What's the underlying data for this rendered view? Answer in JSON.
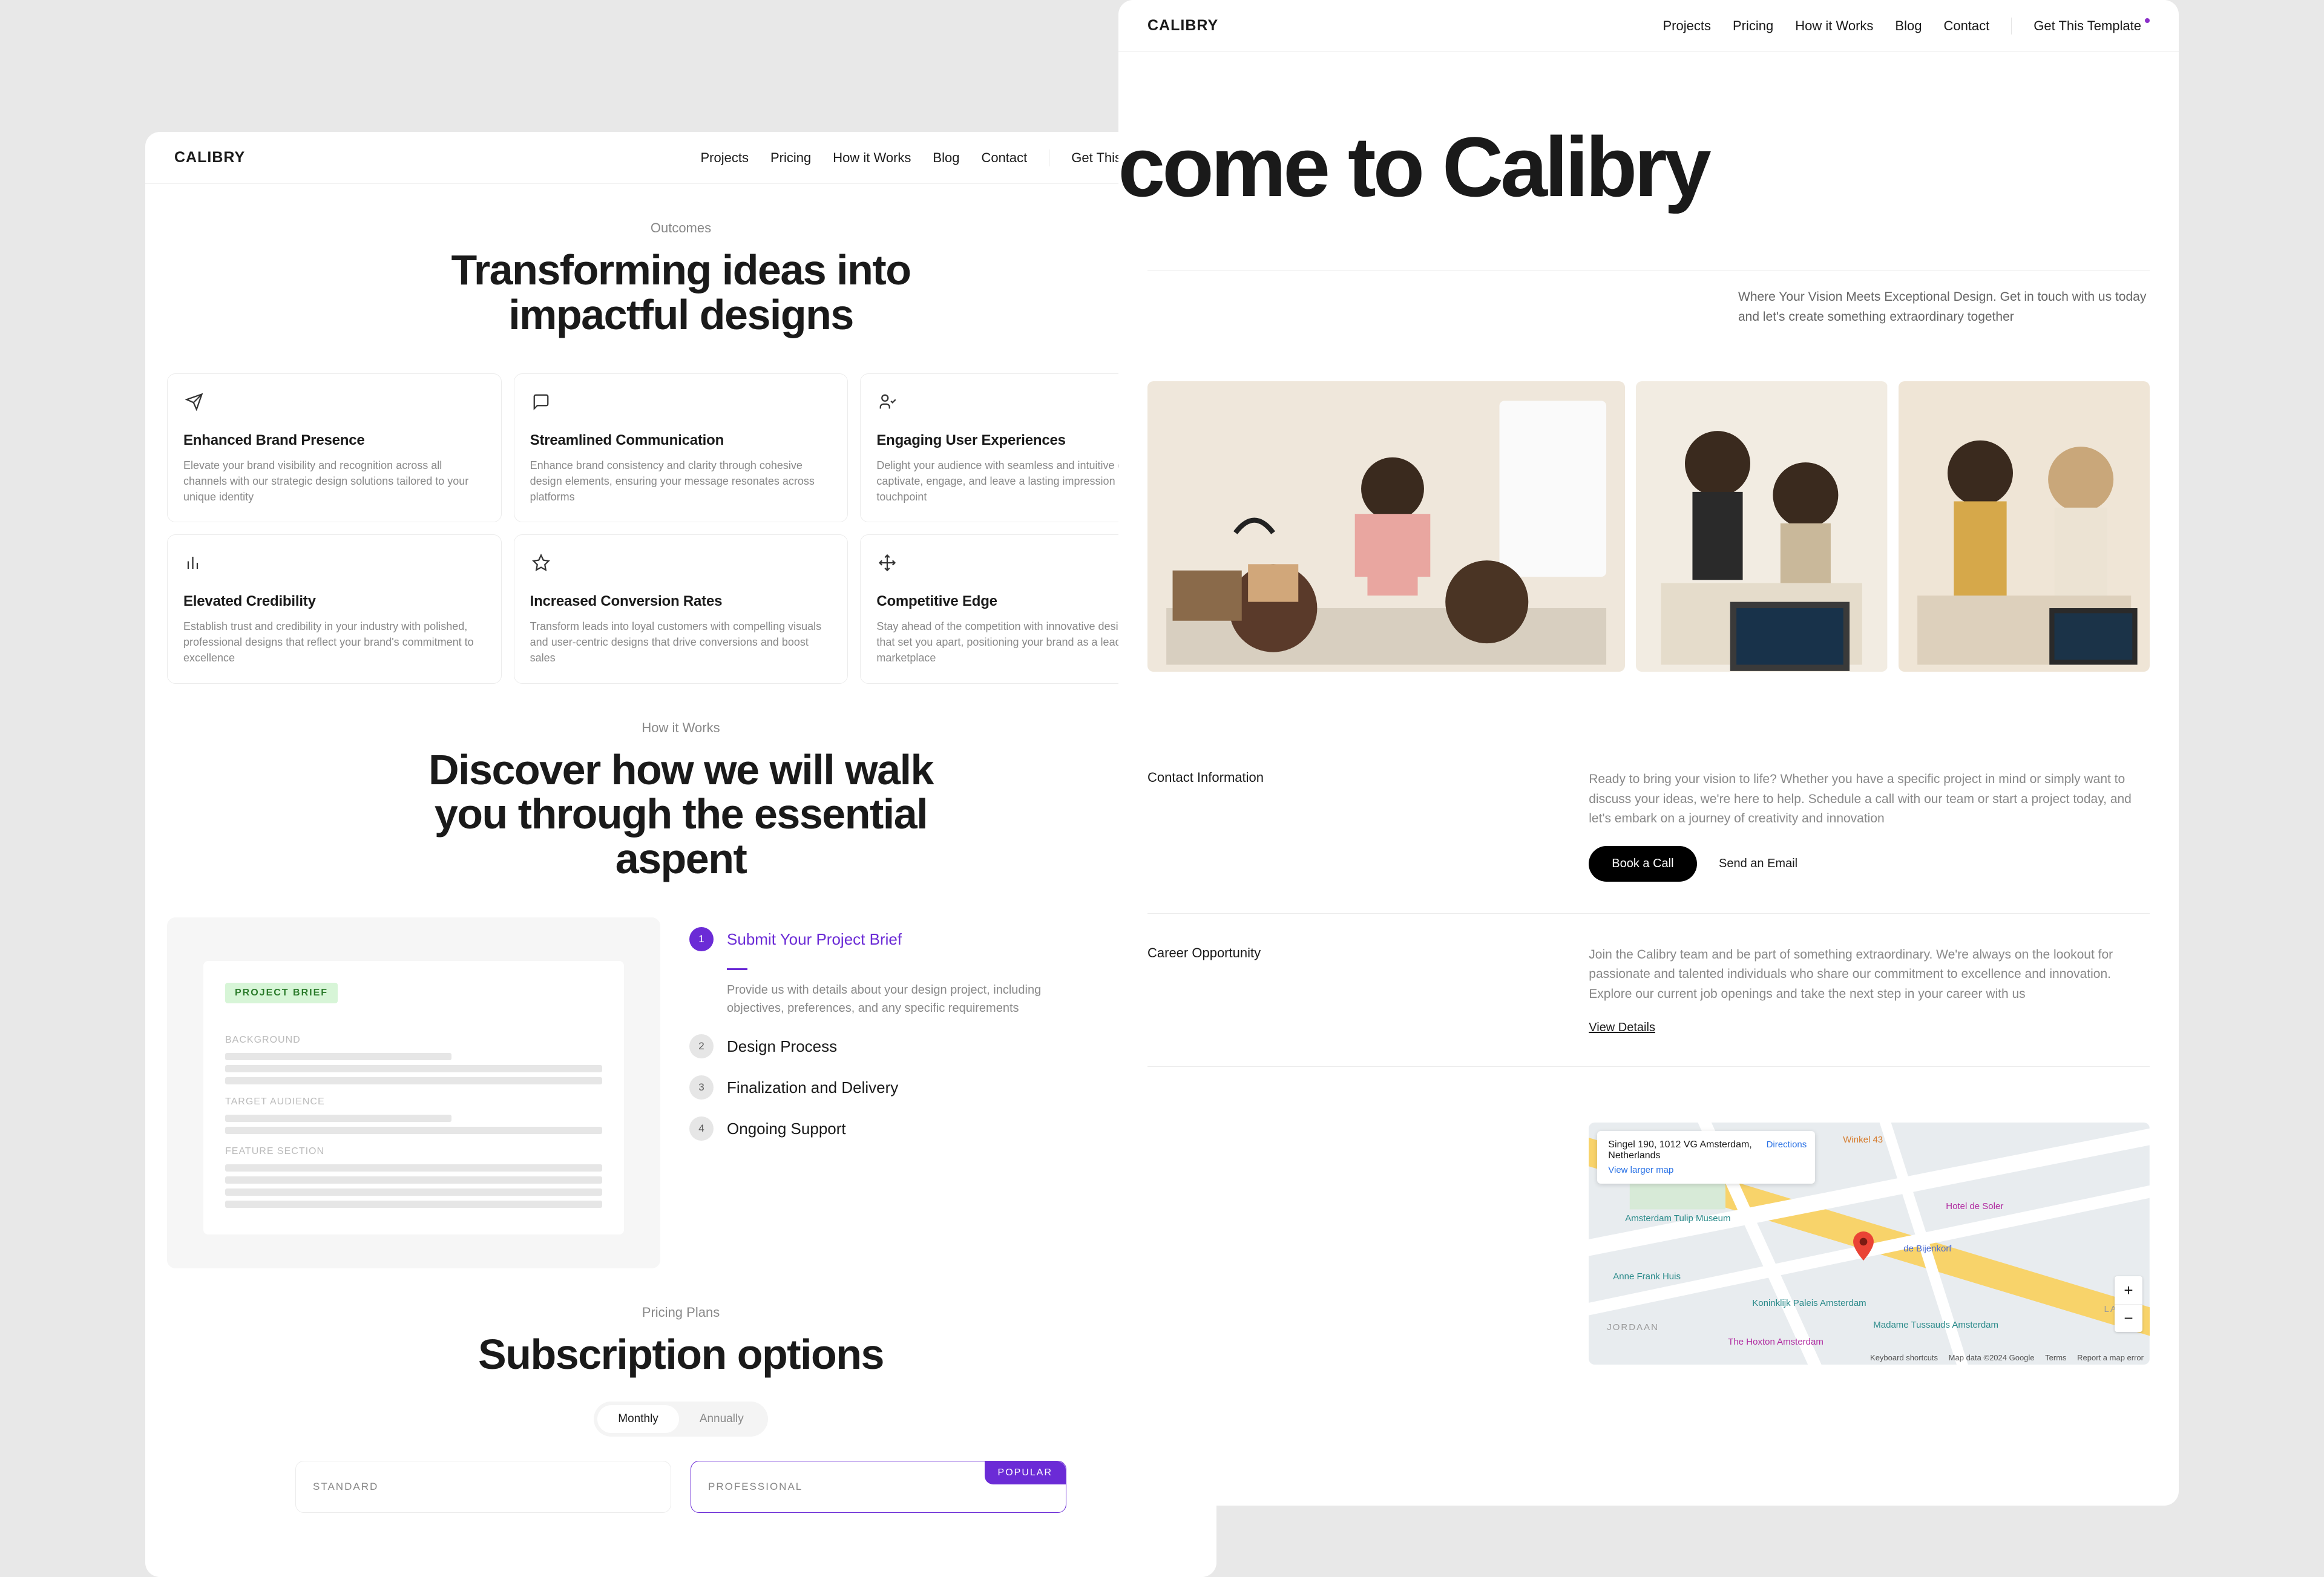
{
  "brand": "CALIBRY",
  "nav": {
    "items": [
      "Projects",
      "Pricing",
      "How it Works",
      "Blog",
      "Contact"
    ],
    "cta": "Get This Template"
  },
  "outcomes": {
    "eyebrow": "Outcomes",
    "heading_l1": "Transforming ideas into",
    "heading_l2": "impactful designs",
    "tiles": [
      {
        "title": "Enhanced Brand Presence",
        "body": "Elevate your brand visibility and recognition across all channels with our strategic design solutions tailored to your unique identity"
      },
      {
        "title": "Streamlined Communication",
        "body": "Enhance brand consistency and clarity through cohesive design elements, ensuring your message resonates across platforms"
      },
      {
        "title": "Engaging User Experiences",
        "body": "Delight your audience with seamless and intuitive designs that captivate, engage, and leave a lasting impression at every touchpoint"
      },
      {
        "title": "Elevated Credibility",
        "body": "Establish trust and credibility in your industry with polished, professional designs that reflect your brand's commitment to excellence"
      },
      {
        "title": "Increased Conversion Rates",
        "body": "Transform leads into loyal customers with compelling visuals and user-centric designs that drive conversions and boost sales"
      },
      {
        "title": "Competitive Edge",
        "body": "Stay ahead of the competition with innovative design solutions that set you apart, positioning your brand as a leader in the marketplace"
      }
    ]
  },
  "how": {
    "eyebrow": "How it Works",
    "heading_l1": "Discover how we will walk",
    "heading_l2": "you through the essential",
    "heading_l3": "aspent",
    "brief": {
      "tag": "PROJECT BRIEF",
      "labels": [
        "BACKGROUND",
        "TARGET AUDIENCE",
        "FEATURE SECTION"
      ]
    },
    "steps": [
      {
        "num": "1",
        "title": "Submit Your Project Brief",
        "body": "Provide us with details about your design project, including objectives, preferences, and any specific requirements"
      },
      {
        "num": "2",
        "title": "Design Process"
      },
      {
        "num": "3",
        "title": "Finalization and Delivery"
      },
      {
        "num": "4",
        "title": "Ongoing Support"
      }
    ]
  },
  "pricing": {
    "eyebrow": "Pricing Plans",
    "heading": "Subscription options",
    "toggle": {
      "monthly": "Monthly",
      "annually": "Annually"
    },
    "plans": [
      {
        "name": "STANDARD"
      },
      {
        "name": "PROFESSIONAL",
        "popular": "POPULAR"
      }
    ]
  },
  "welcome": {
    "hero": "Welcome to Calibry",
    "intro": "Where Your Vision Meets Exceptional Design. Get in touch with us today and let's create something extraordinary together",
    "contact": {
      "label": "Contact Information",
      "body": "Ready to bring your vision to life? Whether you have a specific project in mind or simply want to discuss your ideas, we're here to help. Schedule a call with our team or start a project today, and let's embark on a journey of creativity and innovation",
      "cta_primary": "Book a Call",
      "cta_secondary": "Send an Email"
    },
    "career": {
      "label": "Career Opportunity",
      "body": "Join the Calibry team and be part of something extraordinary. We're always on the lookout for passionate and talented individuals who share our commitment to excellence and innovation. Explore our current job openings and take the next step in your career with us",
      "link": "View Details"
    },
    "map": {
      "address": "Singel 190, 1012 VG Amsterdam, Netherlands",
      "directions": "Directions",
      "larger": "View larger map",
      "labels": [
        "Winkel 43",
        "Amsterdam Tulip Museum",
        "Anne Frank Huis",
        "JORDAAN",
        "de Bijenkorf",
        "Koninklijk Paleis Amsterdam",
        "The Hoxton Amsterdam",
        "Hotel de Soler",
        "Madame Tussauds Amsterdam",
        "LAST"
      ],
      "footer": [
        "Keyboard shortcuts",
        "Map data ©2024 Google",
        "Terms",
        "Report a map error"
      ],
      "plus": "+",
      "minus": "−"
    }
  }
}
